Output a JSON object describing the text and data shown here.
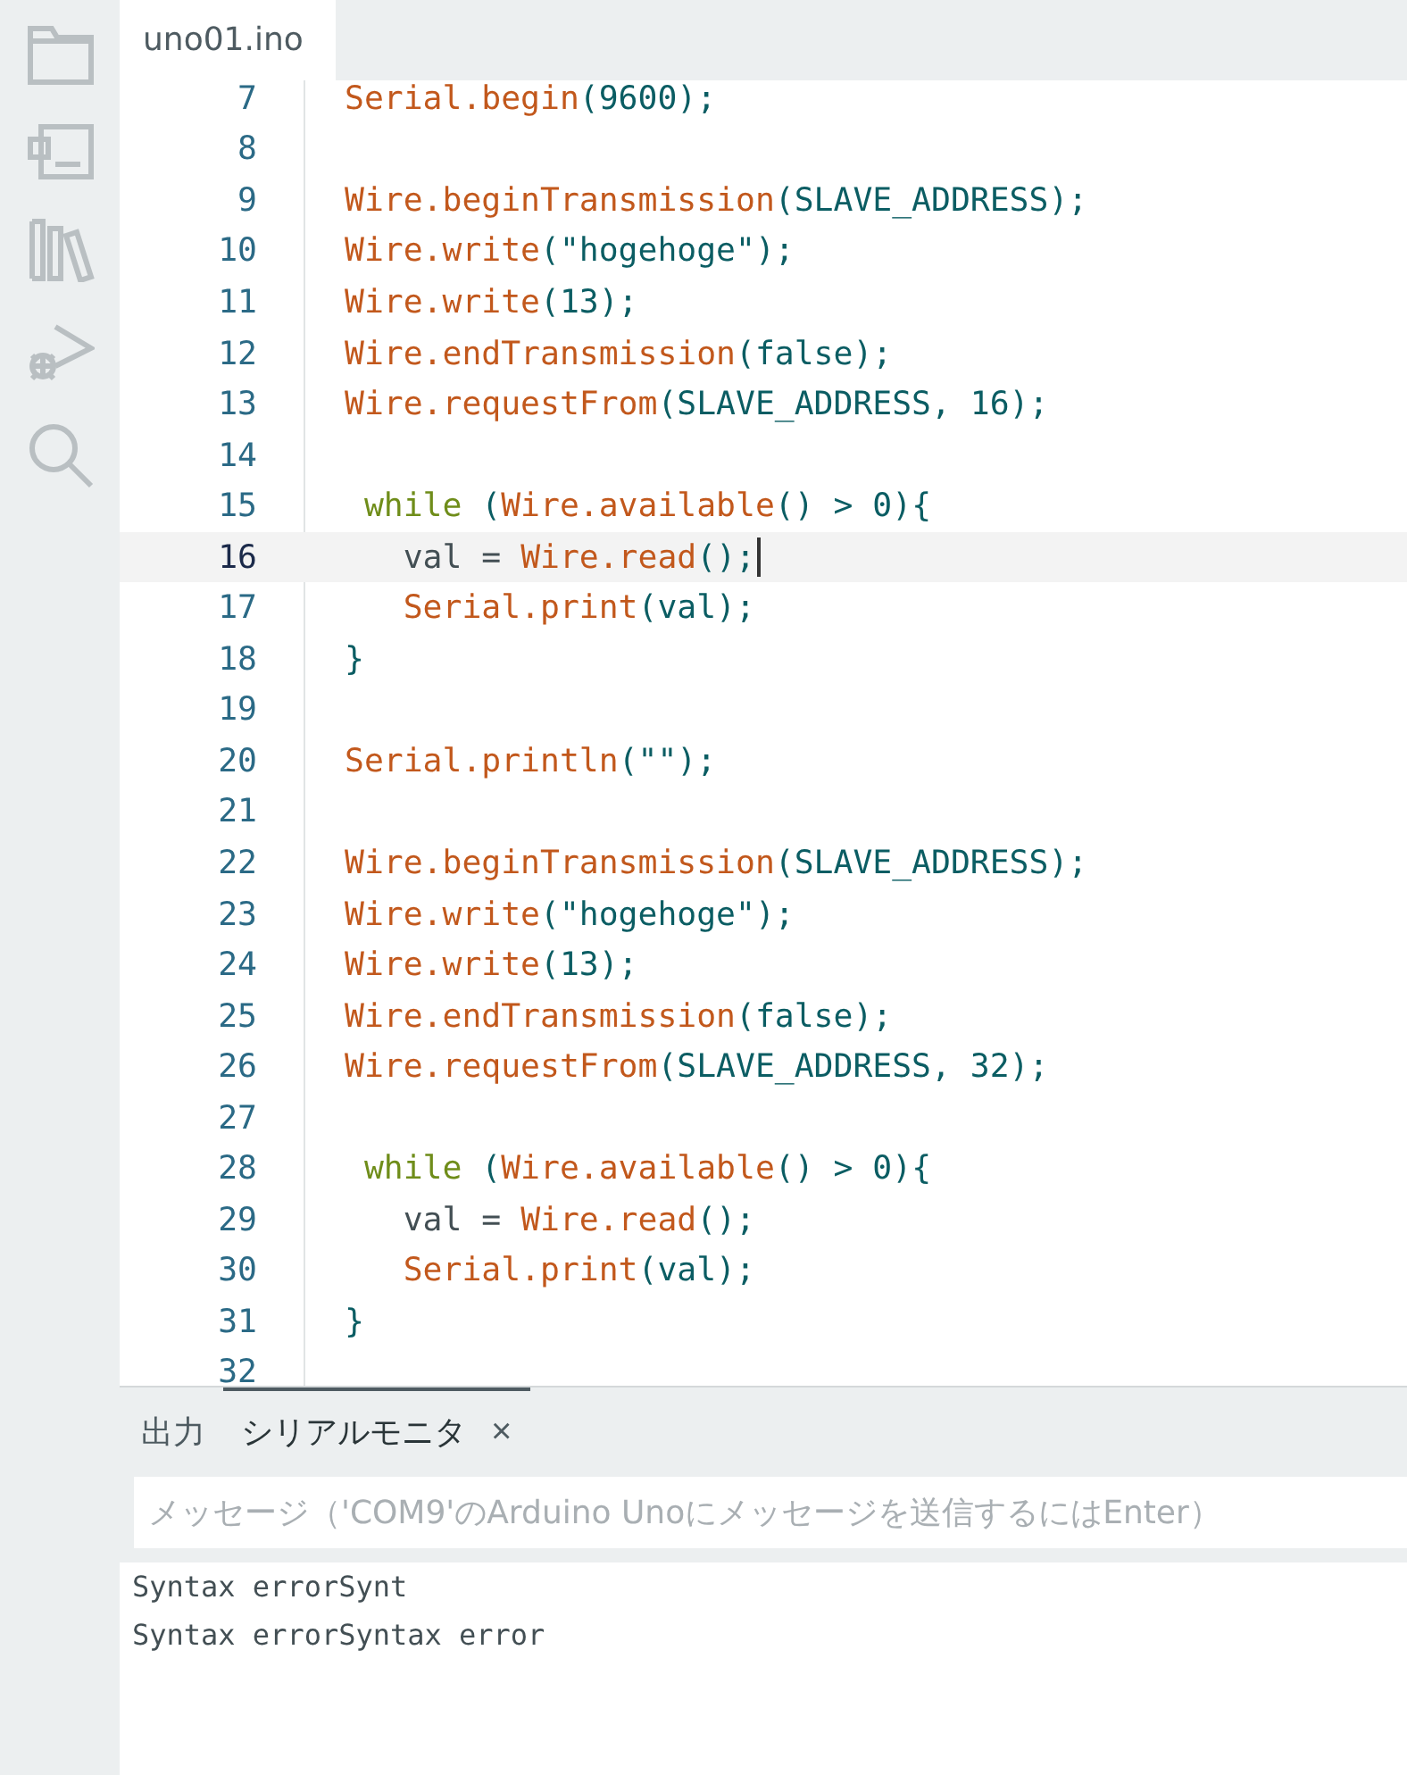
{
  "editor_tabs": [
    {
      "label": "uno01.ino",
      "selected": true
    }
  ],
  "code_lines": [
    {
      "number": "7",
      "current": false,
      "tokens": [
        {
          "text": "Serial.begin",
          "kind": "fn"
        },
        {
          "text": "(9600);",
          "kind": "lit"
        }
      ]
    },
    {
      "number": "8",
      "current": false
    },
    {
      "number": "9",
      "current": false,
      "tokens": [
        {
          "text": "Wire.beginTransmission",
          "kind": "fn"
        },
        {
          "text": "(SLAVE_ADDRESS);",
          "kind": "lit"
        }
      ]
    },
    {
      "number": "10",
      "current": false,
      "tokens": [
        {
          "text": "Wire.write",
          "kind": "fn"
        },
        {
          "text": "(\"hogehoge\");",
          "kind": "lit"
        }
      ]
    },
    {
      "number": "11",
      "current": false,
      "tokens": [
        {
          "text": "Wire.write",
          "kind": "fn"
        },
        {
          "text": "(13);",
          "kind": "lit"
        }
      ]
    },
    {
      "number": "12",
      "current": false,
      "tokens": [
        {
          "text": "Wire.endTransmission",
          "kind": "fn"
        },
        {
          "text": "(false);",
          "kind": "lit"
        }
      ]
    },
    {
      "number": "13",
      "current": false,
      "tokens": [
        {
          "text": "Wire.requestFrom",
          "kind": "fn"
        },
        {
          "text": "(SLAVE_ADDRESS, 16);",
          "kind": "lit"
        }
      ]
    },
    {
      "number": "14",
      "current": false
    },
    {
      "number": "15",
      "current": false,
      "tokens": [
        {
          "text": " while",
          "kind": "kw"
        },
        {
          "text": " (",
          "kind": "lit"
        },
        {
          "text": "Wire.available",
          "kind": "fn"
        },
        {
          "text": "() > 0){",
          "kind": "lit"
        }
      ]
    },
    {
      "number": "16",
      "current": true,
      "tokens": [
        {
          "text": "   val = ",
          "kind": "plain"
        },
        {
          "text": "Wire.read",
          "kind": "fn"
        },
        {
          "text": "();",
          "kind": "lit"
        }
      ]
    },
    {
      "number": "17",
      "current": false,
      "tokens": [
        {
          "text": "   Serial.print",
          "kind": "fn"
        },
        {
          "text": "(val);",
          "kind": "lit"
        }
      ]
    },
    {
      "number": "18",
      "current": false,
      "tokens": [
        {
          "text": "}",
          "kind": "lit"
        }
      ]
    },
    {
      "number": "19",
      "current": false
    },
    {
      "number": "20",
      "current": false,
      "tokens": [
        {
          "text": "Serial.println",
          "kind": "fn"
        },
        {
          "text": "(\"\");",
          "kind": "lit"
        }
      ]
    },
    {
      "number": "21",
      "current": false
    },
    {
      "number": "22",
      "current": false,
      "tokens": [
        {
          "text": "Wire.beginTransmission",
          "kind": "fn"
        },
        {
          "text": "(SLAVE_ADDRESS);",
          "kind": "lit"
        }
      ]
    },
    {
      "number": "23",
      "current": false,
      "tokens": [
        {
          "text": "Wire.write",
          "kind": "fn"
        },
        {
          "text": "(\"hogehoge\");",
          "kind": "lit"
        }
      ]
    },
    {
      "number": "24",
      "current": false,
      "tokens": [
        {
          "text": "Wire.write",
          "kind": "fn"
        },
        {
          "text": "(13);",
          "kind": "lit"
        }
      ]
    },
    {
      "number": "25",
      "current": false,
      "tokens": [
        {
          "text": "Wire.endTransmission",
          "kind": "fn"
        },
        {
          "text": "(false);",
          "kind": "lit"
        }
      ]
    },
    {
      "number": "26",
      "current": false,
      "tokens": [
        {
          "text": "Wire.requestFrom",
          "kind": "fn"
        },
        {
          "text": "(SLAVE_ADDRESS, 32);",
          "kind": "lit"
        }
      ]
    },
    {
      "number": "27",
      "current": false
    },
    {
      "number": "28",
      "current": false,
      "tokens": [
        {
          "text": " while",
          "kind": "kw"
        },
        {
          "text": " (",
          "kind": "lit"
        },
        {
          "text": "Wire.available",
          "kind": "fn"
        },
        {
          "text": "() > 0){",
          "kind": "lit"
        }
      ]
    },
    {
      "number": "29",
      "current": false,
      "tokens": [
        {
          "text": "   val = ",
          "kind": "plain"
        },
        {
          "text": "Wire.read",
          "kind": "fn"
        },
        {
          "text": "();",
          "kind": "lit"
        }
      ]
    },
    {
      "number": "30",
      "current": false,
      "tokens": [
        {
          "text": "   Serial.print",
          "kind": "fn"
        },
        {
          "text": "(val);",
          "kind": "lit"
        }
      ]
    },
    {
      "number": "31",
      "current": false,
      "tokens": [
        {
          "text": "}",
          "kind": "lit"
        }
      ]
    },
    {
      "number": "32",
      "current": false
    }
  ],
  "panel_tabs": [
    {
      "label": "出力",
      "selected": false
    },
    {
      "label": "シリアルモニタ",
      "selected": true,
      "close": "×"
    }
  ],
  "message_input": {
    "placeholder": "メッセージ（'COM9'のArduino Unoにメッセージを送信するにはEnter）"
  },
  "serial_output": [
    "Syntax errorSynt",
    "Syntax errorSyntax error"
  ]
}
